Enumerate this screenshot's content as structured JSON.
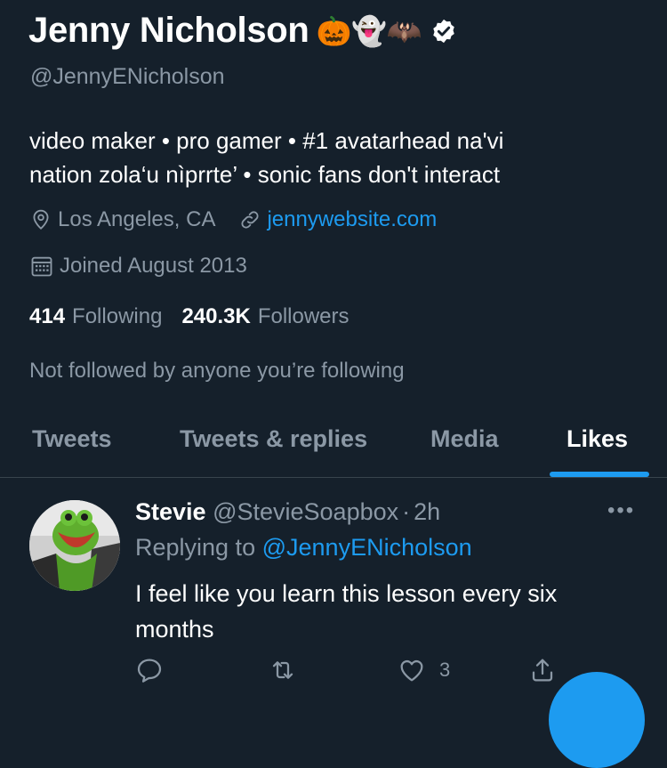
{
  "profile": {
    "display_name": "Jenny Nicholson",
    "name_emojis": "🎃👻🦇",
    "handle": "@JennyENicholson",
    "bio_line1": "video maker • pro gamer • #1 avatarhead na'vi",
    "bio_line2": "nation zola‘u nìprrte’ • sonic fans don't interact",
    "location": "Los Angeles, CA",
    "website": "jennywebsite.com",
    "joined": "Joined August 2013",
    "following_count": "414",
    "following_label": "Following",
    "followers_count": "240.3K",
    "followers_label": "Followers",
    "not_followed_text": "Not followed by anyone you’re following"
  },
  "tabs": [
    {
      "label": "Tweets"
    },
    {
      "label": "Tweets & replies"
    },
    {
      "label": "Media"
    },
    {
      "label": "Likes"
    }
  ],
  "active_tab": "Likes",
  "tweet": {
    "display_name": "Stevie",
    "handle": "@StevieSoapbox",
    "separator": "·",
    "time": "2h",
    "replying_label": "Replying to",
    "replying_to": "@JennyENicholson",
    "text": "I feel like you learn this lesson every six months",
    "like_count": "3",
    "more_label": "•••"
  },
  "icons": {
    "location": "location-pin-icon",
    "link": "link-icon",
    "calendar": "calendar-icon",
    "verified": "verified-badge-icon",
    "reply": "reply-icon",
    "retweet": "retweet-icon",
    "like": "heart-icon",
    "share": "share-icon"
  },
  "colors": {
    "background": "#15202b",
    "accent": "#1d9bf0",
    "secondary_text": "#8b98a5",
    "divider": "#38444d"
  }
}
